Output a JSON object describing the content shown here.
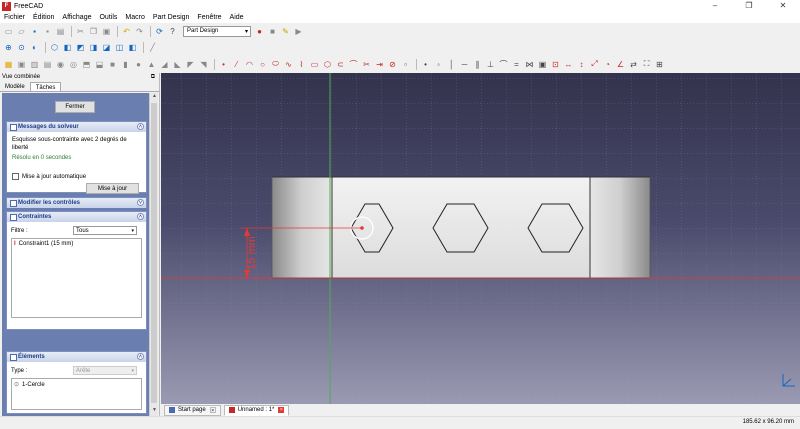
{
  "window": {
    "title": "FreeCAD",
    "app_icon_letter": "F",
    "minimize": "–",
    "maximize": "❐",
    "close": "✕"
  },
  "menu": [
    "Fichier",
    "Édition",
    "Affichage",
    "Outils",
    "Macro",
    "Part Design",
    "Fenêtre",
    "Aide"
  ],
  "toolbar": {
    "workbench": "Part Design"
  },
  "panel": {
    "title": "Vue combinée",
    "tabs": [
      "Modèle",
      "Tâches"
    ],
    "active_tab": "Tâches",
    "close_button": "Fermer",
    "solver": {
      "header": "Messages du solveur",
      "message": "Esquisse sous-contrainte avec 2 degrés de liberté",
      "status": "Résolu en 0 secondes",
      "auto_update_label": "Mise à jour automatique",
      "auto_update_checked": false,
      "update_button": "Mise à jour"
    },
    "edit_controls": {
      "header": "Modifier les contrôles"
    },
    "constraints": {
      "header": "Contraintes",
      "filter_label": "Filtre :",
      "filter_value": "Tous",
      "items": [
        "Constraint1 (15 mm)"
      ]
    },
    "elements": {
      "header": "Éléments",
      "type_label": "Type :",
      "type_value": "Arête",
      "items": [
        "1-Cercle"
      ]
    }
  },
  "viewport": {
    "dimension_label": "15 mm"
  },
  "doc_tabs": [
    "Start page",
    "Unnamed : 1*"
  ],
  "active_doc_tab": "Unnamed : 1*",
  "status": {
    "dimensions": "185.62 x 96.20 mm"
  },
  "colors": {
    "accent_red": "#e53935",
    "axis_green": "#4caf50",
    "panel_bg": "#6a7fb0",
    "header_text": "#1f3f88"
  }
}
